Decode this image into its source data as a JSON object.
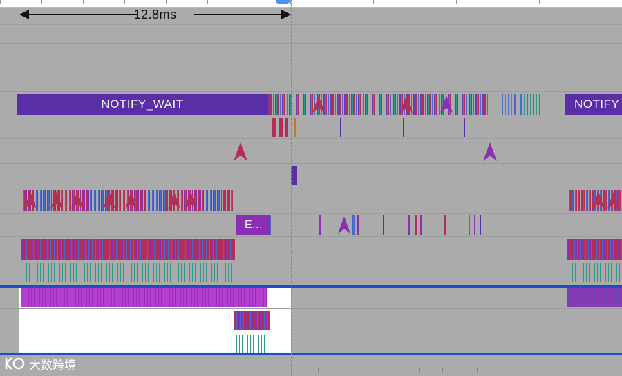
{
  "measure": {
    "label": "12.8ms"
  },
  "slices": {
    "notify_main": "NOTIFY_WAIT",
    "notify_right": "NOTIFY",
    "short": "E..."
  },
  "watermark": {
    "text": "大数跨境"
  },
  "colors": {
    "background": "#ababab",
    "notify": "#5a2ea6",
    "selection_blue": "#4a90ff",
    "band_blue": "#1d4fc4",
    "magenta": "#b53fcf",
    "crimson": "#b32f55",
    "teal": "#2b9a8f"
  },
  "icons": {
    "marker": "flow-arrow-icon",
    "logo": "watermark-logo-icon"
  }
}
